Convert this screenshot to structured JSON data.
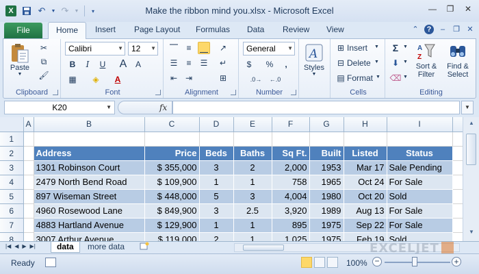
{
  "window": {
    "title": "Make the ribbon mind you.xlsx  -  Microsoft Excel",
    "app_icon": "X"
  },
  "tabs": {
    "file": "File",
    "items": [
      "Home",
      "Insert",
      "Page Layout",
      "Formulas",
      "Data",
      "Review",
      "View"
    ]
  },
  "ribbon": {
    "clipboard": {
      "label": "Clipboard",
      "paste": "Paste"
    },
    "font": {
      "label": "Font",
      "name": "Calibri",
      "size": "12"
    },
    "alignment": {
      "label": "Alignment"
    },
    "number": {
      "label": "Number",
      "format": "General",
      "currency": "$",
      "percent": "%",
      "comma": ","
    },
    "styles": {
      "label": "Styles"
    },
    "cells": {
      "label": "Cells",
      "insert": "Insert",
      "delete": "Delete",
      "format": "Format"
    },
    "editing": {
      "label": "Editing",
      "sort": "Sort &",
      "sort2": "Filter",
      "find": "Find &",
      "find2": "Select"
    }
  },
  "formula_bar": {
    "name_box": "K20",
    "fx": "fx",
    "value": ""
  },
  "sheet": {
    "columns": [
      "A",
      "B",
      "C",
      "D",
      "E",
      "F",
      "G",
      "H",
      "I"
    ],
    "row_numbers": [
      "1",
      "2",
      "3",
      "4",
      "5",
      "6",
      "7",
      "8"
    ],
    "headers": [
      "Address",
      "Price",
      "Beds",
      "Baths",
      "Sq Ft.",
      "Built",
      "Listed",
      "Status"
    ],
    "rows": [
      [
        "1301 Robinson Court",
        "$ 355,000",
        "3",
        "2",
        "2,000",
        "1953",
        "Mar 17",
        "Sale Pending"
      ],
      [
        "2479 North Bend Road",
        "$ 109,900",
        "1",
        "1",
        "758",
        "1965",
        "Oct 24",
        "For Sale"
      ],
      [
        "897 Wiseman Street",
        "$ 448,000",
        "5",
        "3",
        "4,004",
        "1980",
        "Oct 20",
        "Sold"
      ],
      [
        "4960 Rosewood Lane",
        "$ 849,900",
        "3",
        "2.5",
        "3,920",
        "1989",
        "Aug 13",
        "For Sale"
      ],
      [
        "4883 Hartland Avenue",
        "$ 129,900",
        "1",
        "1",
        "895",
        "1975",
        "Sep 22",
        "For Sale"
      ],
      [
        "3007 Arthur Avenue",
        "$ 119,000",
        "2",
        "1",
        "1,025",
        "1975",
        "Feb 19",
        "Sold"
      ]
    ]
  },
  "sheet_tabs": [
    "data",
    "more data"
  ],
  "status": {
    "ready": "Ready",
    "zoom": "100%"
  },
  "watermark": "EXCELJET",
  "colors": {
    "table_header": "#4f81bd",
    "band_dark": "#b8cce4",
    "band_light": "#dce6f1",
    "file_tab": "#1f7244"
  }
}
